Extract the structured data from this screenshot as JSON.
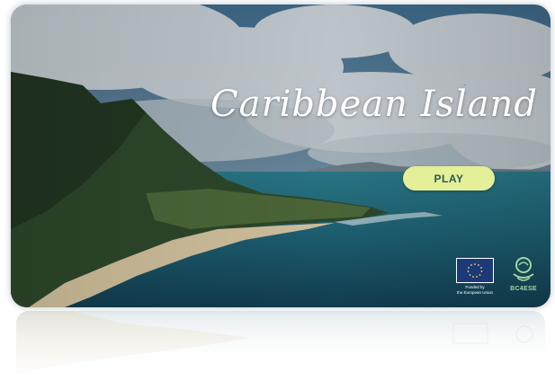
{
  "game": {
    "title": "Caribbean Island",
    "play_label": "PLAY"
  },
  "logos": {
    "eu_caption": "Funded by\nthe European Union",
    "partner": "BC4ESE"
  },
  "colors": {
    "play_bg": "#e4ef97",
    "play_text": "#2a5b55",
    "sea": "#1f5f6e",
    "sky": "#3f6b8a",
    "partner_green": "#9fd6a1"
  }
}
